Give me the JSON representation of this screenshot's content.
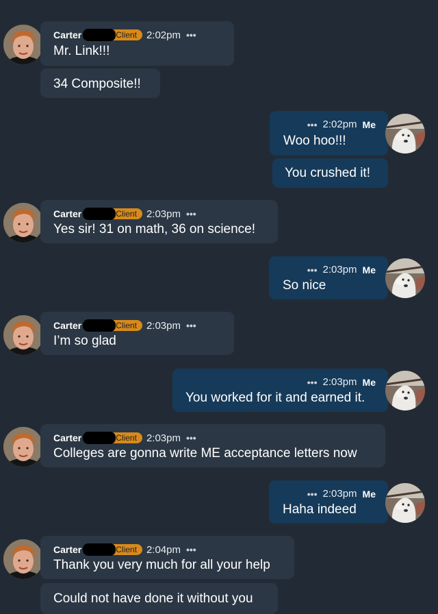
{
  "contact": {
    "name": "Carter",
    "badge": "Client"
  },
  "self": {
    "name": "Me"
  },
  "more_glyph": "•••",
  "messages": [
    {
      "time": "2:02pm",
      "lines": [
        "Mr. Link!!!",
        "34 Composite!!"
      ]
    },
    {
      "time": "2:02pm",
      "lines": [
        "Woo hoo!!!",
        "You crushed it!"
      ]
    },
    {
      "time": "2:03pm",
      "lines": [
        "Yes sir! 31 on math, 36 on science!"
      ]
    },
    {
      "time": "2:03pm",
      "lines": [
        "So nice"
      ]
    },
    {
      "time": "2:03pm",
      "lines": [
        "I’m so glad"
      ]
    },
    {
      "time": "2:03pm",
      "lines": [
        "You worked for it and earned it."
      ]
    },
    {
      "time": "2:03pm",
      "lines": [
        "Colleges are gonna write ME acceptance letters now"
      ]
    },
    {
      "time": "2:03pm",
      "lines": [
        "Haha indeed"
      ]
    },
    {
      "time": "2:04pm",
      "lines": [
        "Thank you very much for all your help",
        "Could not have done it without you"
      ]
    }
  ],
  "colors": {
    "background": "#222b35",
    "incoming_bubble": "#2b3744",
    "outgoing_bubble": "#163a59",
    "client_badge": "#d88a1a"
  }
}
